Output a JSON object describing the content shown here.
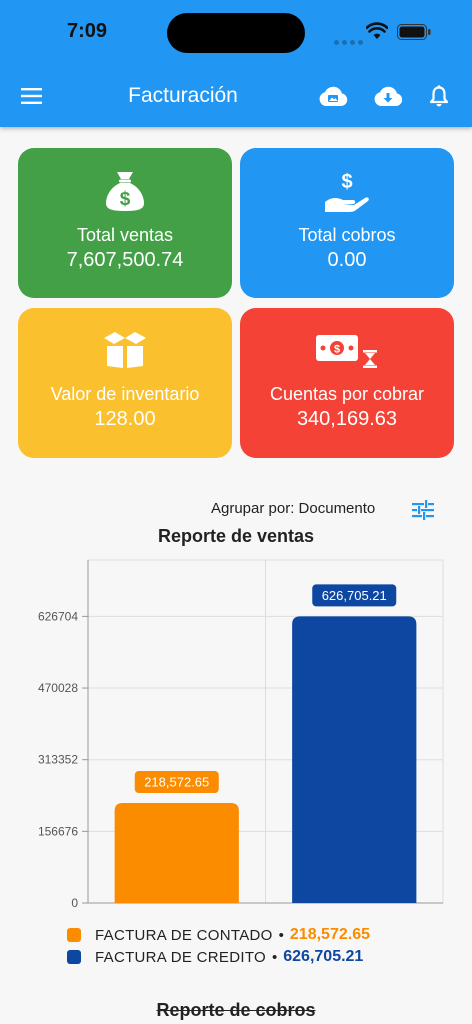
{
  "status": {
    "time": "7:09"
  },
  "header": {
    "title": "Facturación"
  },
  "cards": [
    {
      "label": "Total ventas",
      "value": "7,607,500.74",
      "icon": "money-bag-icon",
      "color": "#43a047"
    },
    {
      "label": "Total cobros",
      "value": "0.00",
      "icon": "hand-dollar-icon",
      "color": "#2196f3"
    },
    {
      "label": "Valor de inventario",
      "value": "128.00",
      "icon": "box-icon",
      "color": "#fbc02d"
    },
    {
      "label": "Cuentas por cobrar",
      "value": "340,169.63",
      "icon": "money-hourglass-icon",
      "color": "#f44336"
    }
  ],
  "group_by": {
    "label": "Agrupar por: Documento"
  },
  "chart_title": "Reporte de ventas",
  "chart_data": {
    "type": "bar",
    "title": "Reporte de ventas",
    "categories": [
      "FACTURA DE CONTADO",
      "FACTURA DE CREDITO"
    ],
    "values": [
      218572.65,
      626705.21
    ],
    "value_labels": [
      "218,572.65",
      "626,705.21"
    ],
    "colors": [
      "#fb8c00",
      "#0d47a1"
    ],
    "ylim": [
      0,
      750000
    ],
    "yticks": [
      0,
      156676,
      313352,
      470028,
      626704
    ],
    "ytick_labels": [
      "0",
      "156676",
      "313352",
      "470028",
      "626704"
    ],
    "grid": true,
    "legend": "bottom"
  },
  "legend": [
    {
      "name": "FACTURA DE CONTADO",
      "value": "218,572.65",
      "color": "#fb8c00"
    },
    {
      "name": "FACTURA DE CREDITO",
      "value": "626,705.21",
      "color": "#0d47a1"
    }
  ],
  "next_section_title": "Reporte de cobros"
}
